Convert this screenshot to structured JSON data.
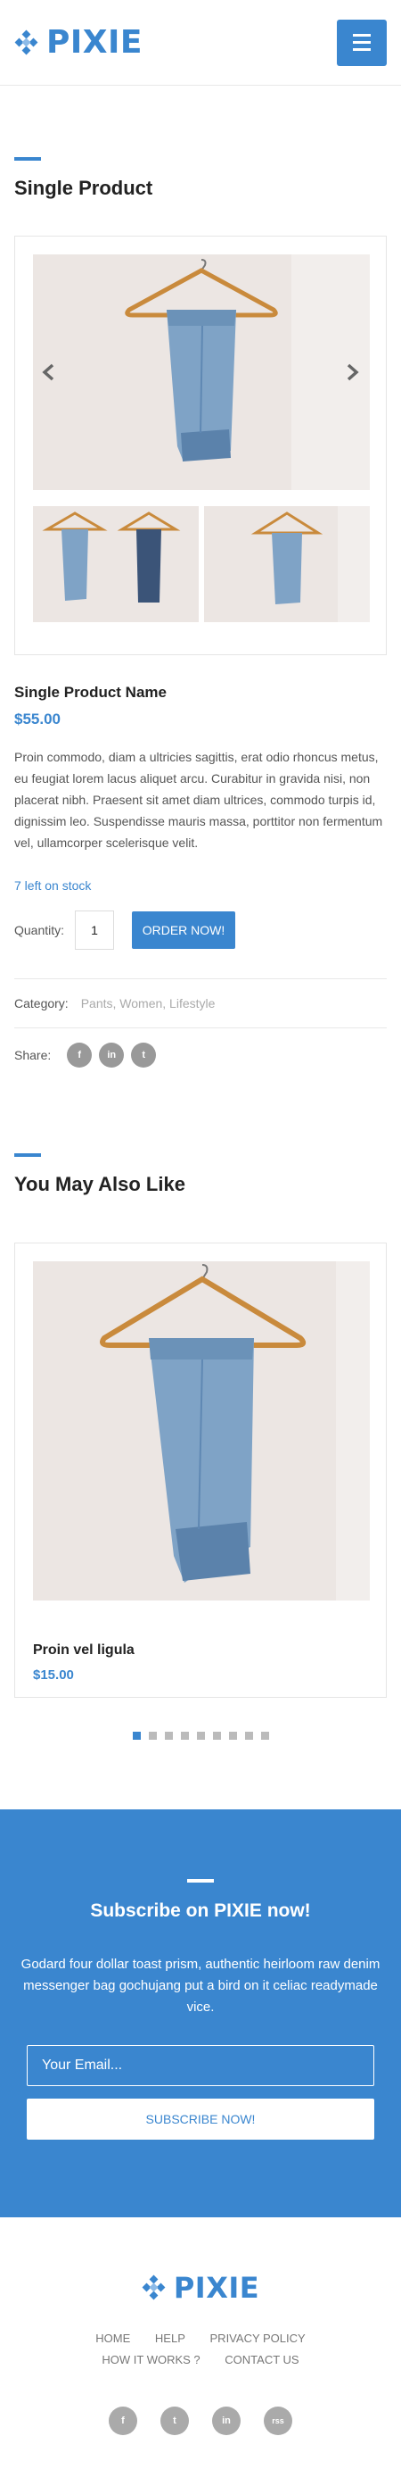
{
  "header": {
    "logo_text": "PIXIE",
    "menu_icon": "hamburger-icon"
  },
  "product_section": {
    "title": "Single Product",
    "gallery": {
      "prev_icon": "chevron-left-icon",
      "next_icon": "chevron-right-icon"
    },
    "name": "Single Product Name",
    "price": "$55.00",
    "description": "Proin commodo, diam a ultricies sagittis, erat odio rhoncus metus, eu feugiat lorem lacus aliquet arcu. Curabitur in gravida nisi, non placerat nibh. Praesent sit amet diam ultrices, commodo turpis id, dignissim leo. Suspendisse mauris massa, porttitor non fermentum vel, ullamcorper scelerisque velit.",
    "stock": "7 left on stock",
    "quantity_label": "Quantity:",
    "quantity_value": "1",
    "order_button": "ORDER NOW!",
    "category_label": "Category:",
    "category_value": "Pants, Women, Lifestyle",
    "share_label": "Share:",
    "share_icons": [
      "f",
      "in",
      "t"
    ]
  },
  "related_section": {
    "title": "You May Also Like",
    "item": {
      "name": "Proin vel ligula",
      "price": "$15.00"
    },
    "dots_count": 9,
    "active_dot": 0
  },
  "subscribe": {
    "title": "Subscribe on PIXIE now!",
    "text": "Godard four dollar toast prism, authentic heirloom raw denim messenger bag gochujang put a bird on it celiac readymade vice.",
    "email_placeholder": "Your Email...",
    "button": "SUBSCRIBE NOW!"
  },
  "footer": {
    "logo_text": "PIXIE",
    "nav": [
      "HOME",
      "HELP",
      "PRIVACY POLICY",
      "HOW IT WORKS ?",
      "CONTACT US"
    ],
    "social": [
      "f",
      "t",
      "in",
      "rss"
    ]
  },
  "colors": {
    "accent": "#3a86cf",
    "bg_photo": "#ece6e3"
  }
}
